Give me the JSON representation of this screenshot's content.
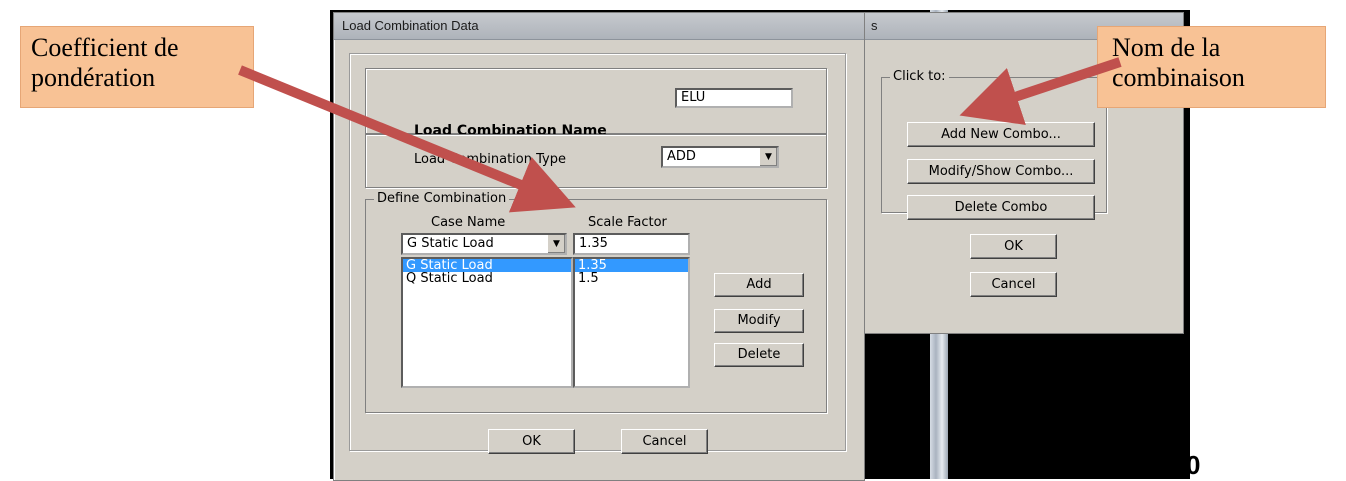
{
  "background_text": "0",
  "right_dialog": {
    "title_fragment": "s",
    "group_label": "Click to:",
    "buttons": [
      "Add New Combo...",
      "Modify/Show Combo...",
      "Delete Combo"
    ],
    "ok_label": "OK",
    "cancel_label": "Cancel"
  },
  "main_dialog": {
    "title": "Load Combination Data",
    "name_label": "Load Combination Name",
    "name_value": "ELU",
    "type_label": "Load Combination Type",
    "type_value": "ADD",
    "define_group_label": "Define Combination",
    "case_name_header": "Case Name",
    "scale_factor_header": "Scale Factor",
    "case_name_selected": "G Static Load",
    "scale_factor_value": "1.35",
    "case_list": [
      "G Static Load",
      "Q Static Load"
    ],
    "factor_list": [
      "1.35",
      "1.5"
    ],
    "add_label": "Add",
    "modify_label": "Modify",
    "delete_label": "Delete",
    "ok_label": "OK",
    "cancel_label": "Cancel"
  },
  "callouts": {
    "left": [
      "Coefficient de",
      "pondération"
    ],
    "right": [
      "Nom de la",
      "combinaison"
    ]
  },
  "colors": {
    "callout_fill": "#f8c295",
    "arrow": "#c0504d",
    "selection": "#3399ff",
    "dialog_face": "#d4d0c8"
  }
}
